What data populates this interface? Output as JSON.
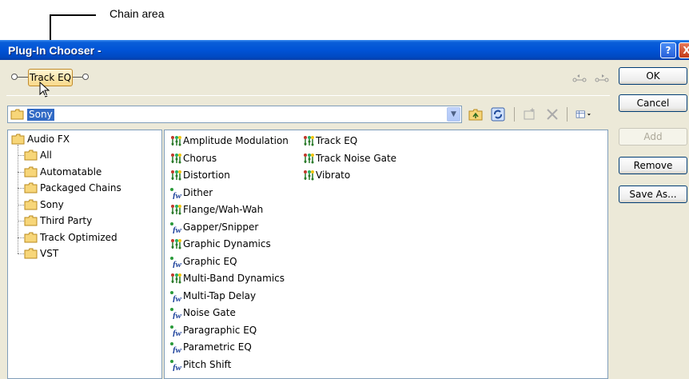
{
  "annotation": {
    "label": "Chain area"
  },
  "window": {
    "title": "Plug-In Chooser -",
    "help_glyph": "?",
    "close_glyph": "X"
  },
  "chain": {
    "plugin_label": "Track EQ"
  },
  "path": {
    "value": "Sony"
  },
  "buttons": {
    "ok": "OK",
    "cancel": "Cancel",
    "add": "Add",
    "remove": "Remove",
    "save_as": "Save As..."
  },
  "tree": {
    "root": "Audio FX",
    "children": [
      "All",
      "Automatable",
      "Packaged Chains",
      "Sony",
      "Third Party",
      "Track Optimized",
      "VST"
    ]
  },
  "plugins": {
    "column1": [
      {
        "name": "Amplitude Modulation",
        "icon": "sony-plugin-icon"
      },
      {
        "name": "Chorus",
        "icon": "sony-plugin-icon"
      },
      {
        "name": "Distortion",
        "icon": "sony-plugin-icon"
      },
      {
        "name": "Dither",
        "icon": "fx-plugin-icon"
      },
      {
        "name": "Flange/Wah-Wah",
        "icon": "sony-plugin-icon"
      },
      {
        "name": "Gapper/Snipper",
        "icon": "fx-plugin-icon"
      },
      {
        "name": "Graphic Dynamics",
        "icon": "sony-plugin-icon"
      },
      {
        "name": "Graphic EQ",
        "icon": "fx-plugin-icon"
      },
      {
        "name": "Multi-Band Dynamics",
        "icon": "sony-plugin-icon"
      },
      {
        "name": "Multi-Tap Delay",
        "icon": "fx-plugin-icon"
      },
      {
        "name": "Noise Gate",
        "icon": "fx-plugin-icon"
      },
      {
        "name": "Paragraphic EQ",
        "icon": "fx-plugin-icon"
      },
      {
        "name": "Parametric EQ",
        "icon": "fx-plugin-icon"
      },
      {
        "name": "Pitch Shift",
        "icon": "fx-plugin-icon"
      }
    ],
    "column2": [
      {
        "name": "Track EQ",
        "icon": "sony-plugin-icon"
      },
      {
        "name": "Track Noise Gate",
        "icon": "sony-plugin-icon"
      },
      {
        "name": "Vibrato",
        "icon": "sony-plugin-icon"
      }
    ]
  },
  "colors": {
    "titlebar": "#0053d6",
    "selection": "#316ac5",
    "window_bg": "#ece9d8"
  }
}
